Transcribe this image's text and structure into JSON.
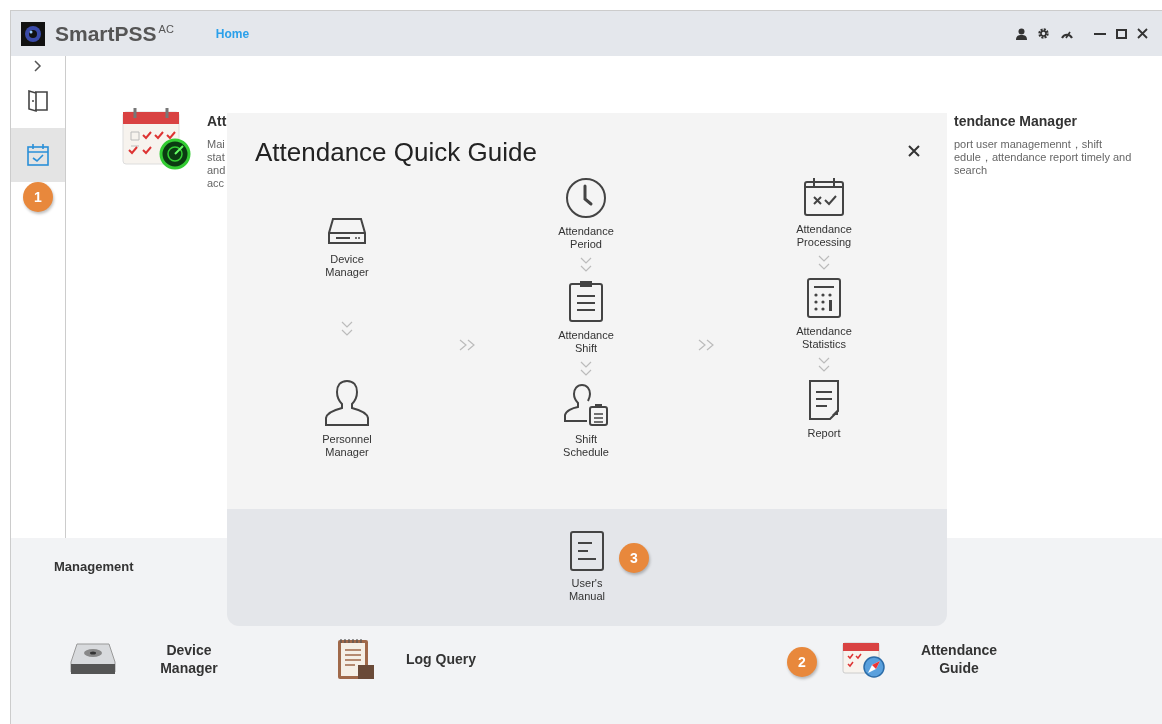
{
  "titlebar": {
    "app_name": "SmartPSS$^{AC}$",
    "tabs": [
      {
        "label": "Home",
        "selected": true
      }
    ]
  },
  "sidebar": {
    "items": [
      {
        "kind": "door",
        "selected": false
      },
      {
        "kind": "calendar",
        "selected": true,
        "badge": "1"
      }
    ]
  },
  "cards": [
    {
      "title": "Att",
      "description": [
        "Mai",
        "stat",
        "and",
        "acc"
      ]
    },
    {
      "title": "tendance Manager",
      "description": [
        "port user managemennt，shift",
        "edule，attendance report timely and",
        "search"
      ]
    }
  ],
  "dialog": {
    "title": "Attendance Quick Guide",
    "columns": [
      {
        "steps": [
          {
            "kind": "drive",
            "label": "Device Manager"
          },
          {
            "kind": "person",
            "label": "Personnel Manager"
          }
        ]
      },
      {
        "steps": [
          {
            "kind": "clock",
            "label": "Attendance Period"
          },
          {
            "kind": "clipboard",
            "label": "Attendance Shift"
          },
          {
            "kind": "person-clipboard",
            "label": "Shift Schedule"
          }
        ]
      },
      {
        "steps": [
          {
            "kind": "calendar",
            "label": "Attendance Processing"
          },
          {
            "kind": "calculator",
            "label": "Attendance Statistics"
          },
          {
            "kind": "report",
            "label": "Report"
          }
        ]
      }
    ],
    "manual": {
      "label": "User's Manual",
      "badge": "3"
    }
  },
  "management": {
    "title": "Management",
    "items": [
      {
        "kind": "drive",
        "label": "Device Manager"
      },
      {
        "kind": "log",
        "label": "Log Query"
      },
      {
        "kind": "guide",
        "label": "Attendance Guide",
        "badge": "2"
      }
    ]
  }
}
